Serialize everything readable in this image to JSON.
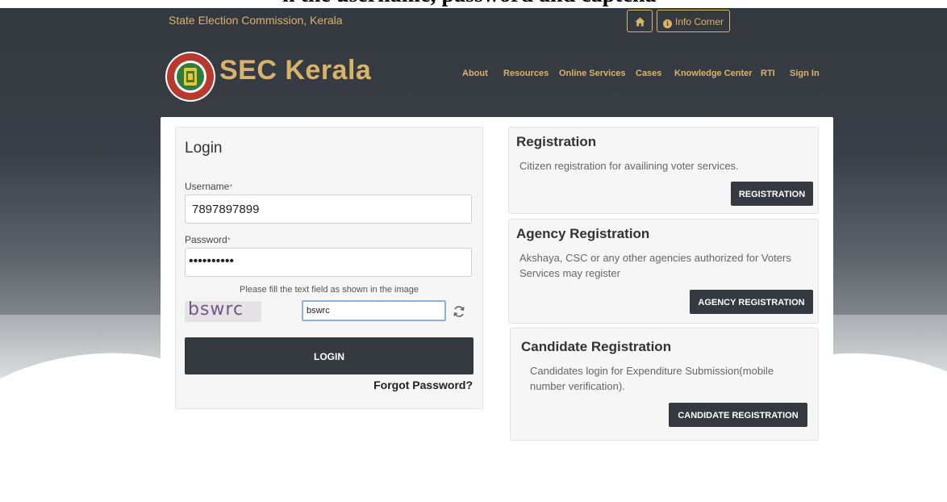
{
  "header": {
    "caption_fragment": "n the username, password and captcha",
    "site_name": "State Election Commission, Kerala",
    "info_corner_label": "Info Corner",
    "logo_text": "SEC Kerala",
    "nav": [
      {
        "label": "About"
      },
      {
        "label": "Resources"
      },
      {
        "label": "Online Services"
      },
      {
        "label": "Cases"
      },
      {
        "label": "Knowledge Center"
      },
      {
        "label": "RTI"
      },
      {
        "label": "Sign In"
      }
    ],
    "accent_color": "#d8b46a"
  },
  "login": {
    "title": "Login",
    "username_label": "Username",
    "username_value": "7897897899",
    "required_mark": "*",
    "password_label": "Password",
    "password_value": "••••••••••",
    "captcha_hint": "Please fill the text field as shown in the image",
    "captcha_image_text": "bswrc",
    "captcha_value": "bswrc",
    "login_label": "LOGIN",
    "forgot_label": "Forgot Password?"
  },
  "registration": {
    "title": "Registration",
    "description": "Citizen registration for availining voter services.",
    "button_label": "REGISTRATION"
  },
  "agency": {
    "title": "Agency Registration",
    "description": "Akshaya, CSC or any other agencies authorized for Voters Services may register",
    "button_label": "AGENCY REGISTRATION"
  },
  "candidate": {
    "title": "Candidate Registration",
    "description": "Candidates login for Expenditure Submission(mobile number verification).",
    "button_label": "CANDIDATE REGISTRATION"
  }
}
